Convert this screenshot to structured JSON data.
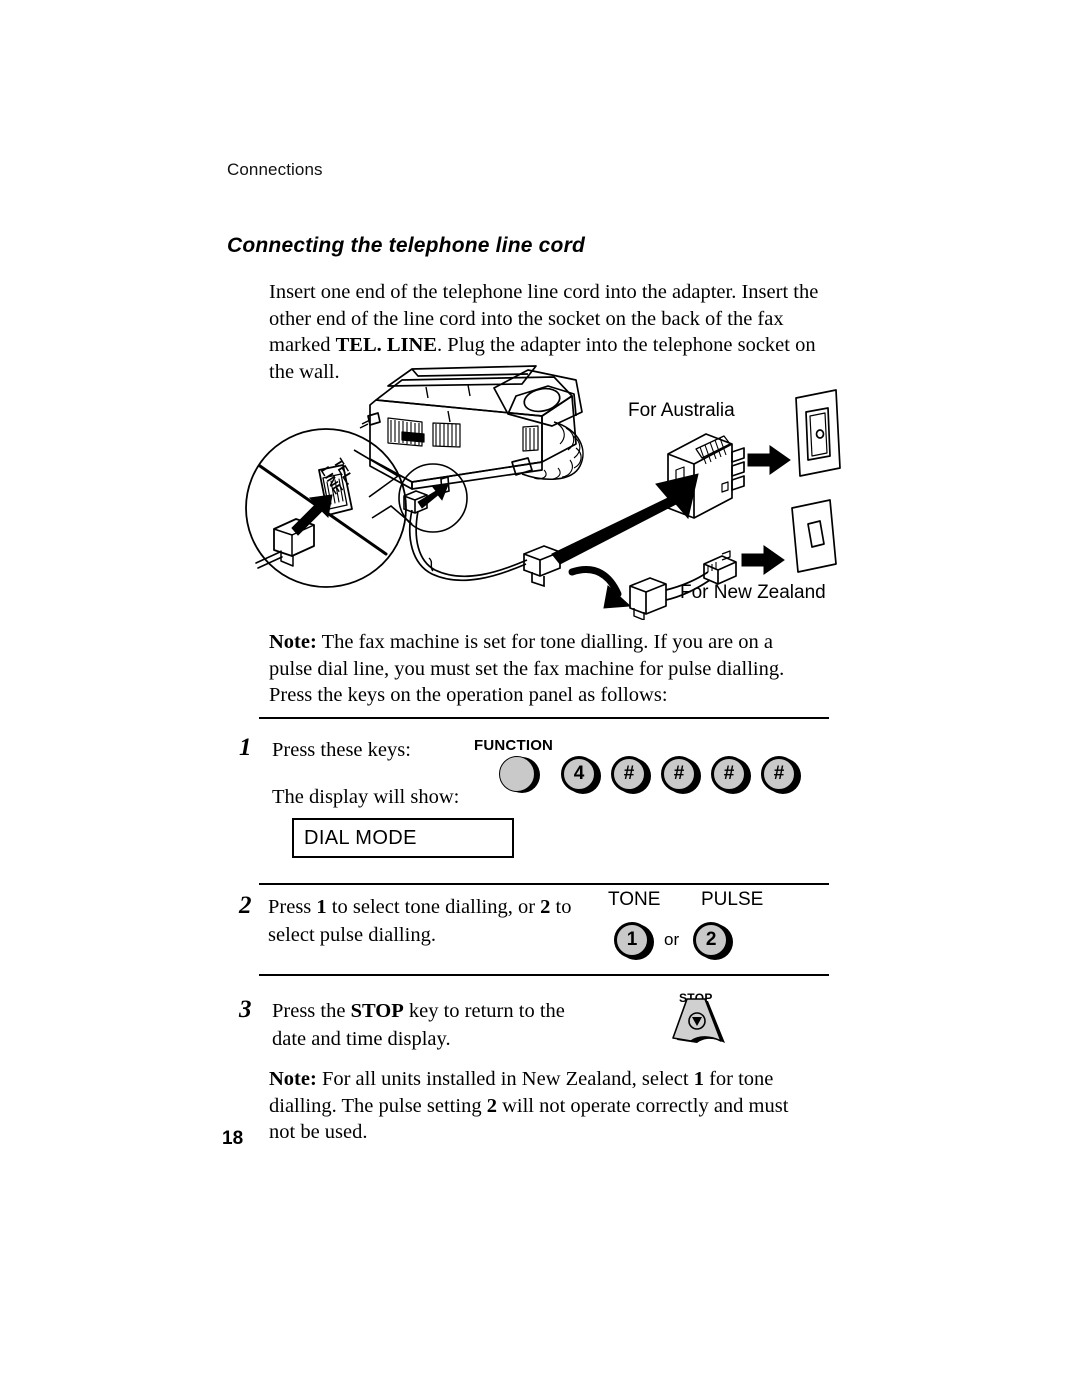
{
  "page": {
    "running_head": "Connections",
    "number": "18"
  },
  "heading": "Connecting the telephone line cord",
  "intro": {
    "part1": "Insert one end of the telephone line cord into the adapter. Insert the other end of the line cord into the socket on the back of the fax marked ",
    "emphasis": "TEL. LINE",
    "part2": ". Plug the adapter into the telephone socket on the wall."
  },
  "illustration": {
    "callout_label_line1": "TEL.",
    "callout_label_line2": "LINE",
    "label_australia": "For Australia",
    "label_new_zealand": "For New Zealand"
  },
  "note_top": {
    "label": "Note:",
    "text": " The fax machine is set for tone dialling. If you are on a pulse dial line, you must set the fax machine for pulse dialling. Press the keys on the operation panel as follows:"
  },
  "steps": {
    "step1": {
      "number": "1",
      "line1": "Press these keys:",
      "line2": "The display will show:",
      "function_caption": "FUNCTION",
      "keys": [
        "4",
        "#",
        "#",
        "#",
        "#"
      ],
      "display_value": "DIAL MODE"
    },
    "step2": {
      "number": "2",
      "text_part1": "Press ",
      "bold1": "1",
      "text_part2": " to select tone dialling, or ",
      "bold2": "2",
      "text_part3": " to select pulse dialling.",
      "tone_caption": "TONE",
      "pulse_caption": "PULSE",
      "key_tone": "1",
      "or_label": "or",
      "key_pulse": "2"
    },
    "step3": {
      "number": "3",
      "text_part1": "Press the ",
      "bold1": "STOP",
      "text_part2": " key to return to the date and time display.",
      "stop_caption": "STOP"
    }
  },
  "note_bottom": {
    "label": "Note:",
    "part1": " For all units installed in New Zealand, select ",
    "bold1": "1",
    "part2": " for tone dialling. The pulse setting ",
    "bold2": "2",
    "part3": " will not operate correctly and must not be used."
  },
  "colors": {
    "key_fill": "#c9c9c9",
    "ink": "#000000",
    "paper": "#ffffff"
  }
}
